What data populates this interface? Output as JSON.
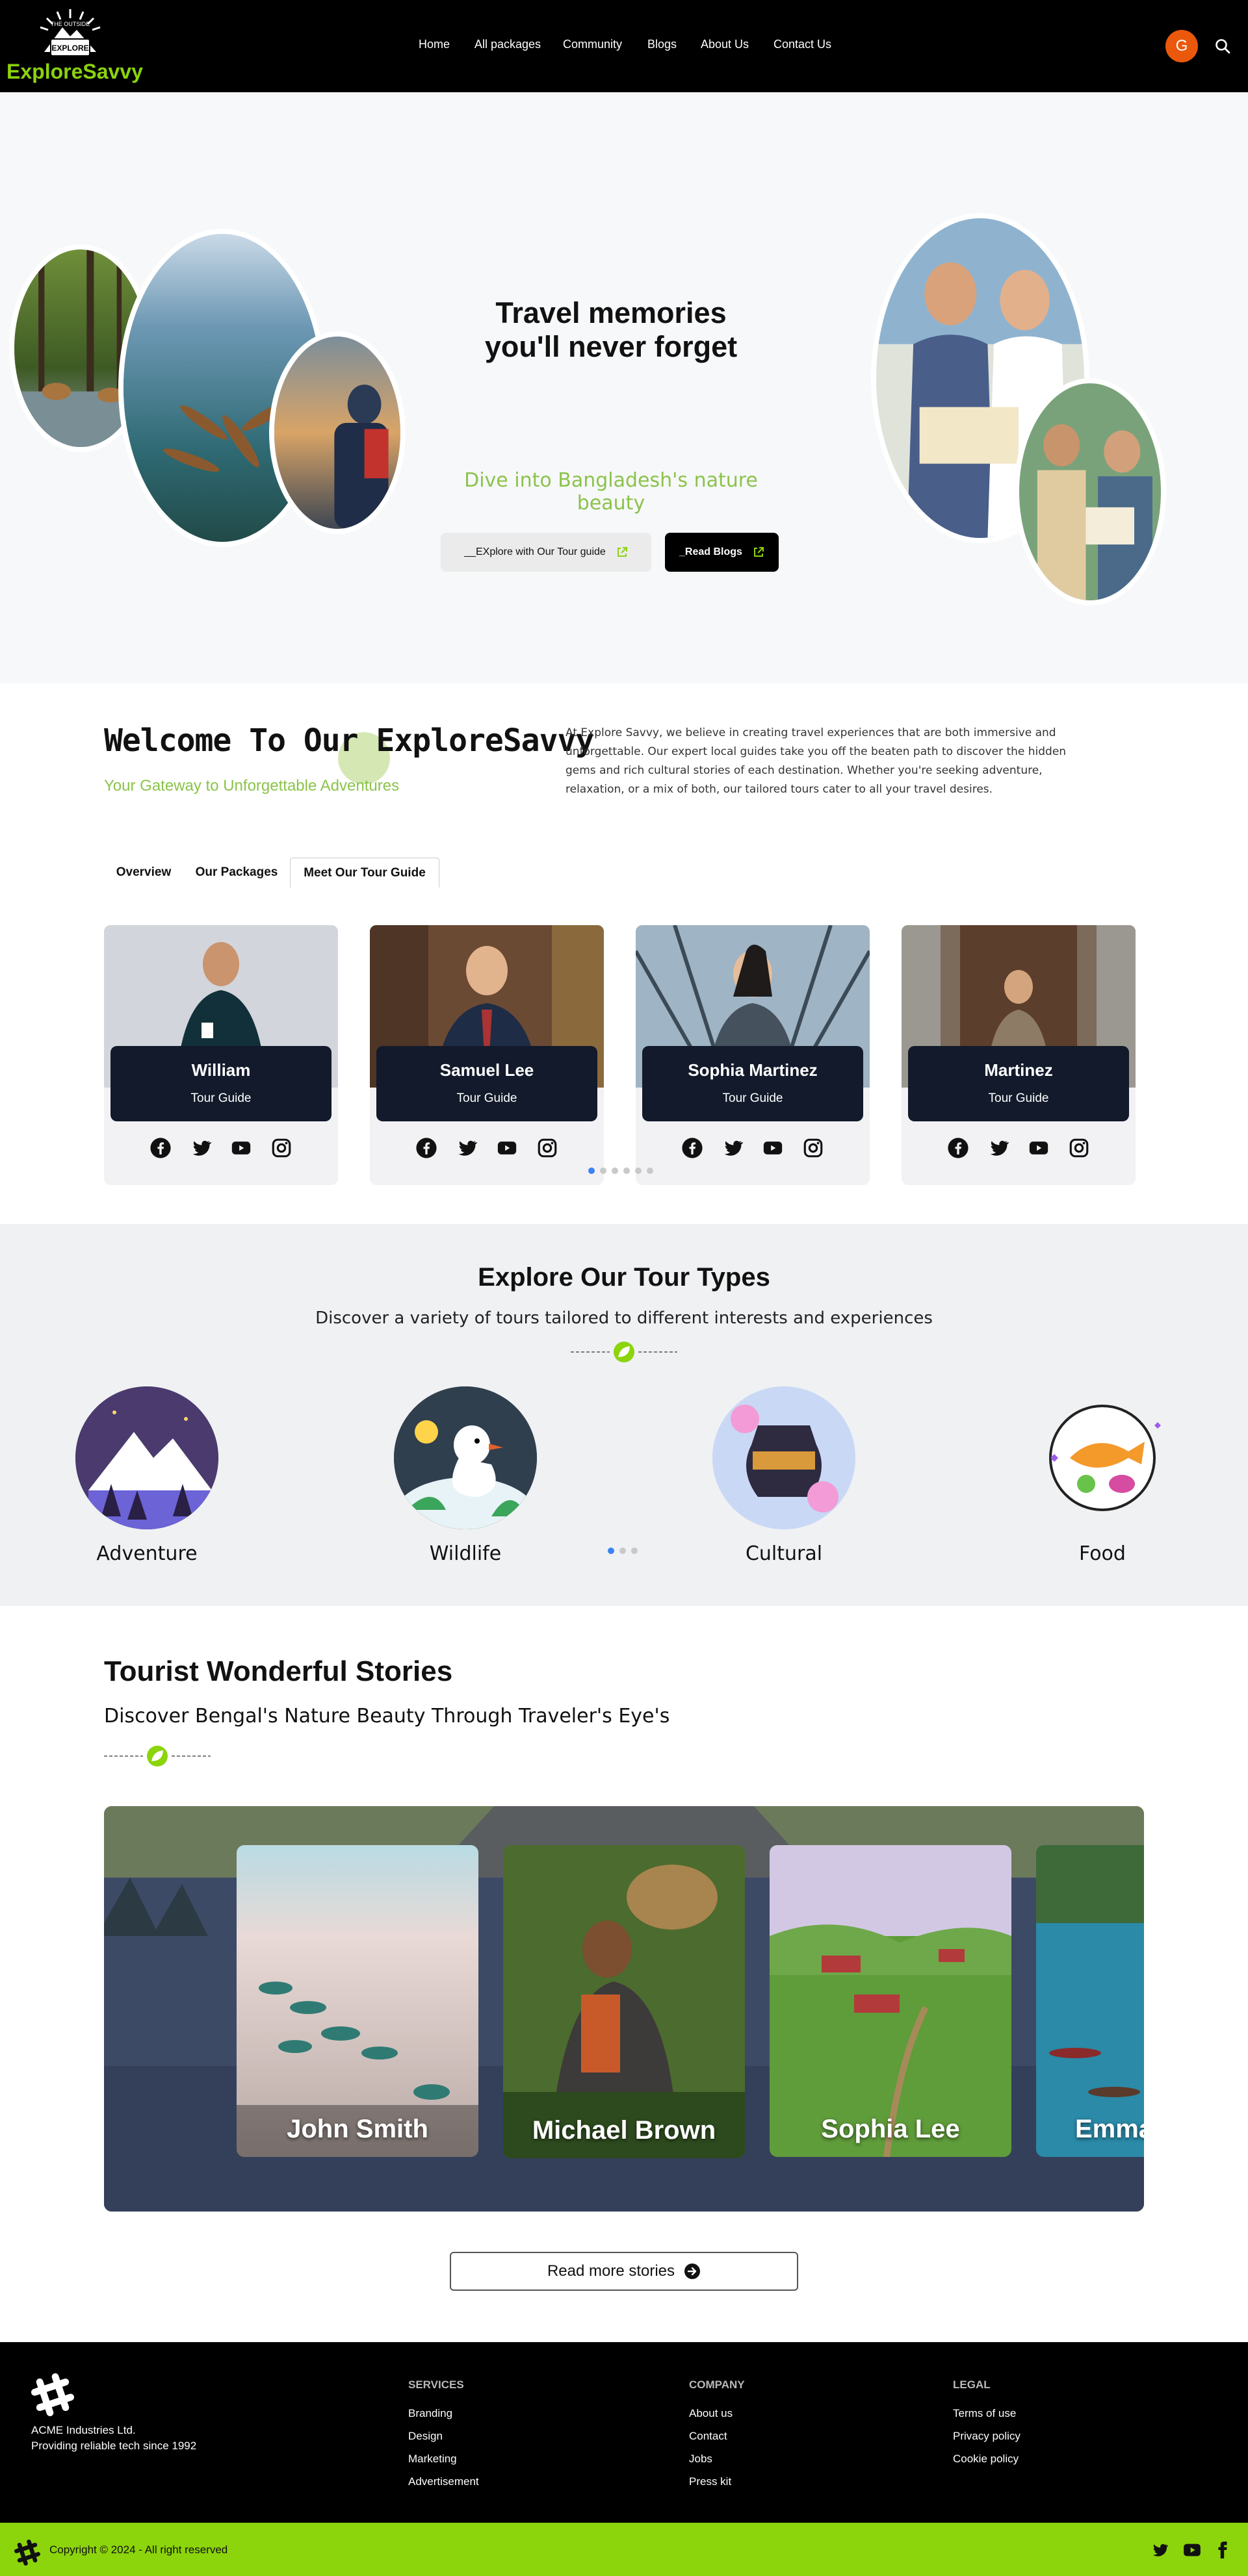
{
  "nav": {
    "logo_badge_top": "THE OUTSIDE",
    "logo_badge_main": "EXPLORE",
    "logo_text": "ExploreSavvy",
    "links": [
      "Home",
      "All packages",
      "Community",
      "Blogs",
      "About Us",
      "Contact Us"
    ],
    "avatar_initial": "G"
  },
  "hero": {
    "title_line1": "Travel memories",
    "title_line2": "you'll never forget",
    "subtitle": "Dive into Bangladesh's nature beauty",
    "btn_guide": "__EXplore with Our Tour guide",
    "btn_blogs": "_Read Blogs"
  },
  "welcome": {
    "title": "Welcome To Our ExploreSavvy",
    "subtitle": "Your Gateway to Unforgettable Adventures",
    "body": "At Explore Savvy, we believe in creating travel experiences that are both immersive and unforgettable. Our expert local guides take you off the beaten path to discover the hidden gems and rich cultural stories of each destination. Whether you're seeking adventure, relaxation, or a mix of both, our tailored tours cater to all your travel desires."
  },
  "tabs": [
    "Overview",
    "Our Packages",
    "Meet Our Tour Guide"
  ],
  "guides": [
    {
      "name": "William",
      "role": "Tour Guide"
    },
    {
      "name": "Samuel Lee",
      "role": "Tour Guide"
    },
    {
      "name": "Sophia Martinez",
      "role": "Tour Guide"
    },
    {
      "name": "Martinez",
      "role": "Tour Guide"
    }
  ],
  "tour_types": {
    "title": "Explore Our Tour Types",
    "subtitle": "Discover a variety of tours tailored to different interests and experiences",
    "items": [
      "Adventure",
      "Wildlife",
      "Cultural",
      "Food"
    ]
  },
  "stories": {
    "title": "Tourist Wonderful Stories",
    "subtitle": "Discover Bengal's Nature Beauty Through Traveler's Eye's",
    "cards": [
      "John Smith",
      "Michael Brown",
      "Sophia Lee",
      "Emma"
    ],
    "read_more": "Read more stories"
  },
  "footer": {
    "company_name": "ACME Industries Ltd.",
    "tagline": "Providing reliable tech since 1992",
    "services_head": "SERVICES",
    "services": [
      "Branding",
      "Design",
      "Marketing",
      "Advertisement"
    ],
    "company_head": "COMPANY",
    "company": [
      "About us",
      "Contact",
      "Jobs",
      "Press kit"
    ],
    "legal_head": "LEGAL",
    "legal": [
      "Terms of use",
      "Privacy policy",
      "Cookie policy"
    ],
    "copyright": "Copyright © 2024 - All right reserved"
  },
  "colors": {
    "accent_green": "#8cd40c",
    "avatar_orange": "#ea580c",
    "guide_plate": "#121a2b",
    "carousel_dot_active": "#3b82f6"
  }
}
